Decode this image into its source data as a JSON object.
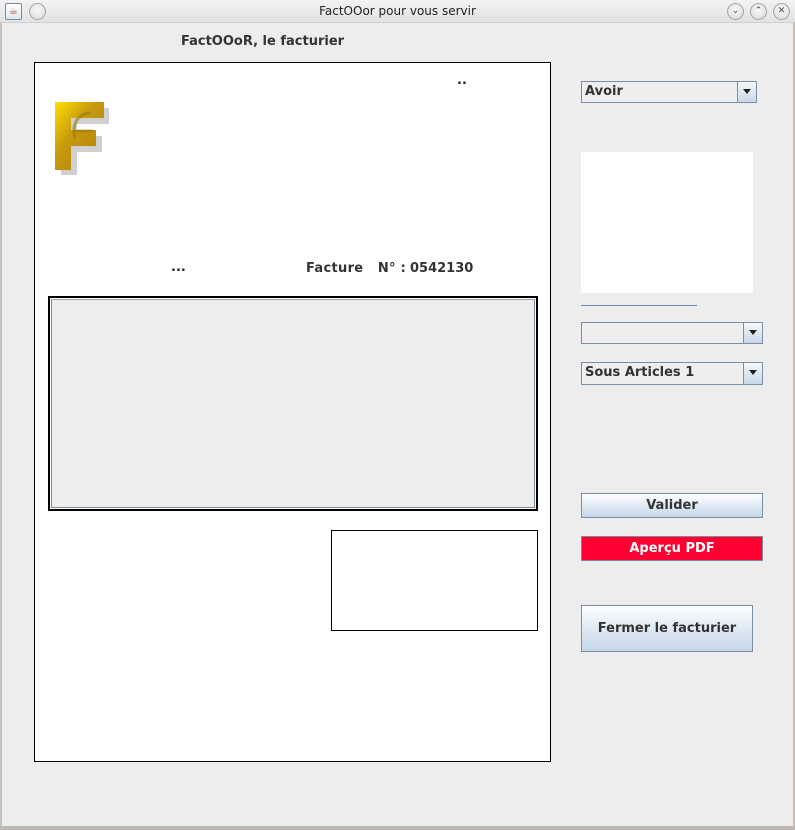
{
  "window": {
    "title": "FactOOor pour vous servir",
    "controls": [
      "minimize",
      "maximize",
      "close"
    ]
  },
  "app": {
    "heading": "FactOOoR, le facturier"
  },
  "invoice": {
    "logo_icon": "factooor-logo-icon",
    "top_placeholder": "..",
    "client_placeholder": "...",
    "facture_label": "Facture   N° :",
    "facture_number": "0542130"
  },
  "sidebar": {
    "document_type": "Avoir",
    "article_select": "",
    "sub_article_select": "Sous Articles 1",
    "validate_label": "Valider",
    "pdf_preview_label": "Aperçu PDF",
    "close_label": "Fermer le facturier",
    "pdf_button_color": "#ff0033"
  }
}
